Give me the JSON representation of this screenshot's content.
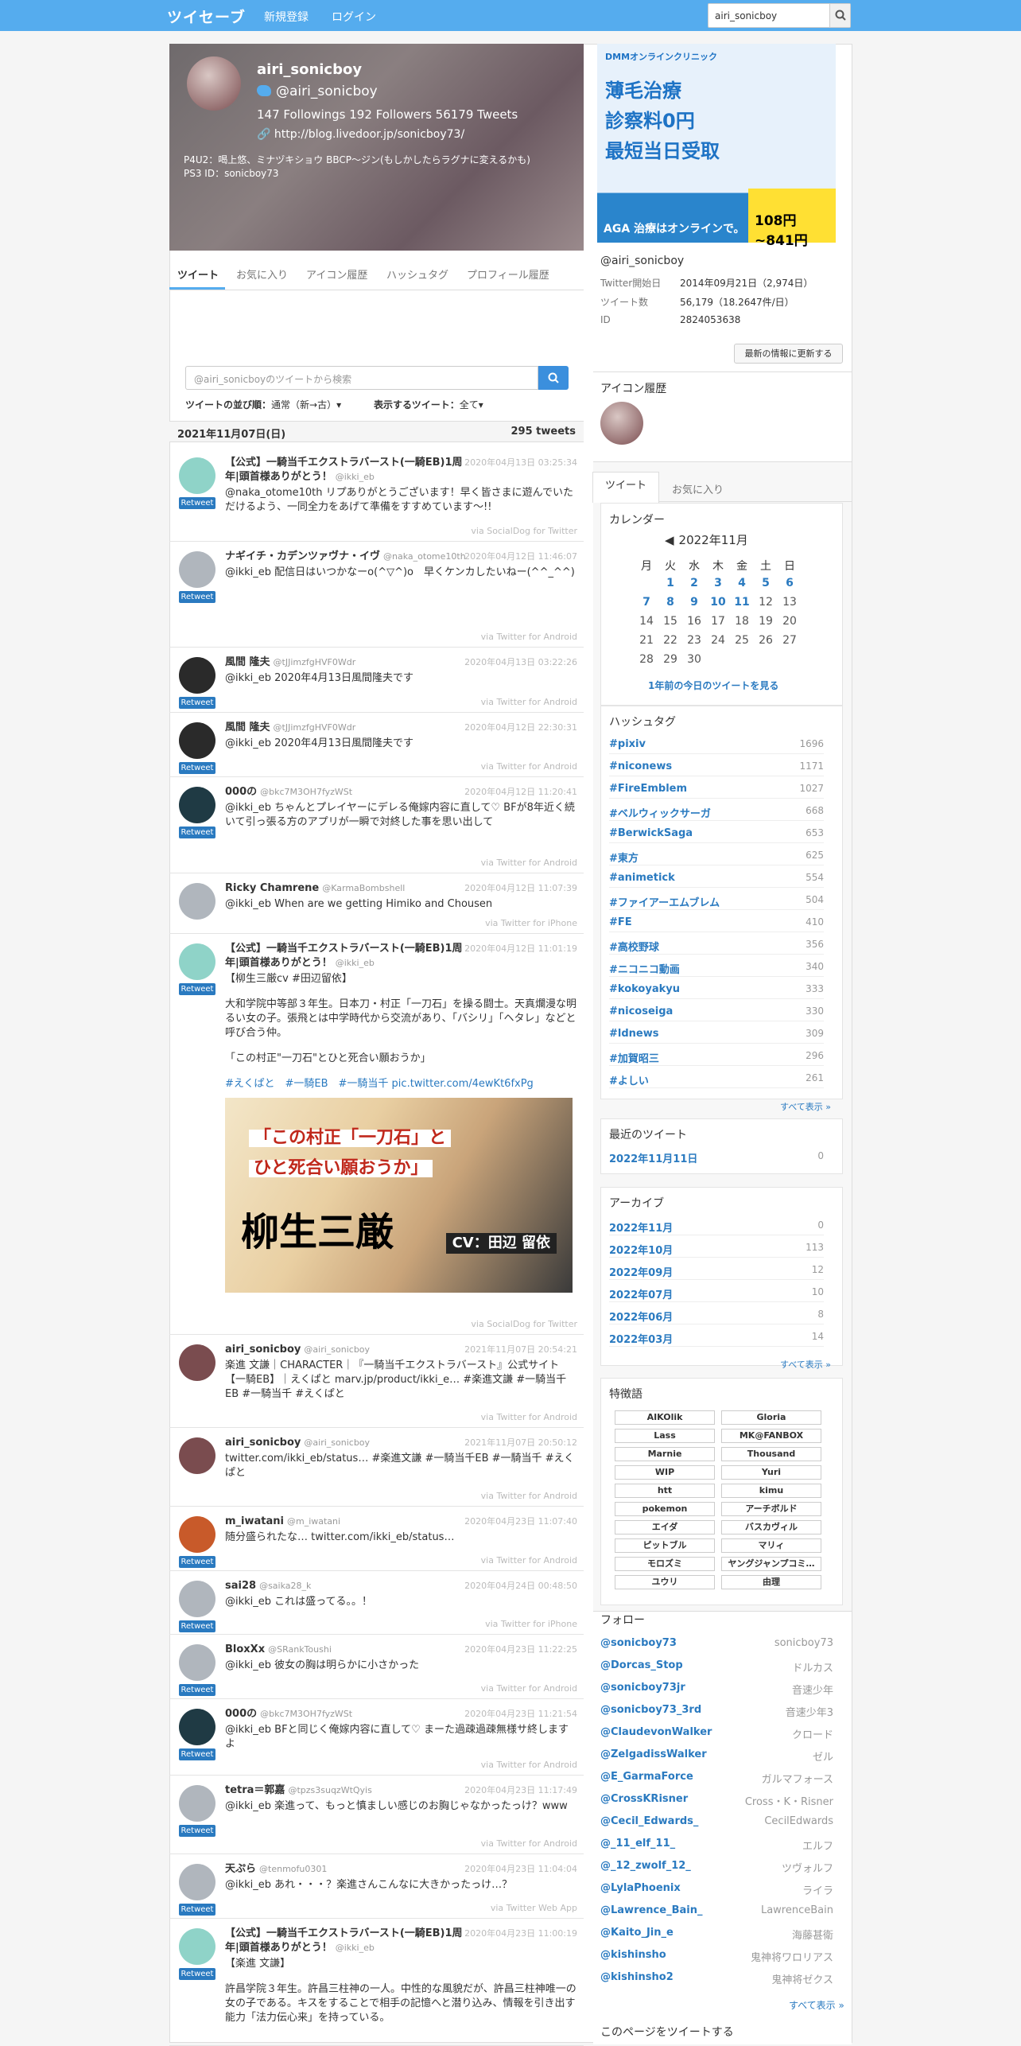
{
  "topbar": {
    "logo": "ツイセーブ",
    "signup": "新規登録",
    "login": "ログイン",
    "search_value": "airi_sonicboy"
  },
  "profile": {
    "name": "airi_sonicboy",
    "screen_name": "@airi_sonicboy",
    "counts": "147 Followings  192 Followers  56179 Tweets",
    "url": "http://blog.livedoor.jp/sonicboy73/",
    "bio1": "P4U2：喝上悠、ミナヅキショウ BBCP～ジン(もしかしたらラグナに変えるかも)",
    "bio2": "PS3 ID：sonicboy73"
  },
  "tabs": [
    "ツイート",
    "お気に入り",
    "アイコン履歴",
    "ハッシュタグ",
    "プロフィール履歴"
  ],
  "search": {
    "placeholder": "@airi_sonicboyのツイートから検索"
  },
  "sort": {
    "order_label": "ツイートの並び順：",
    "order_value": "通常（新→古）▾",
    "show_label": "表示するツイート：",
    "show_value": "全て▾"
  },
  "datebar": {
    "date": "2021年11月07日(日)",
    "count": "295 tweets"
  },
  "rt_label": "Retweet",
  "tweets": [
    {
      "name": "【公式】一騎当千エクストラバースト(一騎EB)1周年|頭首様ありがとう！",
      "sn": "@ikki_eb",
      "time": "2020年04月13日 03:25:34",
      "text": "@naka_otome10th リプありがとうございます！早く皆さまに遊んでいただけるよう、一同全力をあげて準備をすすめています～!!",
      "via": "via SocialDog for Twitter"
    },
    {
      "name": "ナギイチ・カデンツァヴナ・イヴ",
      "sn": "@naka_otome10th",
      "time": "2020年04月12日 11:46:07",
      "text": "@ikki_eb 配信日はいつかなーo(^▽^)o　早くケンカしたいねー(^^_^^)",
      "via": "via Twitter for Android"
    },
    {
      "name": "風間 隆夫",
      "sn": "@tJJimzfgHVF0Wdr",
      "time": "2020年04月13日 03:22:26",
      "text": "@ikki_eb 2020年4月13日風間隆夫です",
      "via": "via Twitter for Android"
    },
    {
      "name": "風間 隆夫",
      "sn": "@tJJimzfgHVF0Wdr",
      "time": "2020年04月12日 22:30:31",
      "text": "@ikki_eb 2020年4月13日風間隆夫です",
      "via": "via Twitter for Android"
    },
    {
      "name": "000の",
      "sn": "@bkc7M3OH7fyzWSt",
      "time": "2020年04月12日 11:20:41",
      "text": "@ikki_eb ちゃんとプレイヤーにデレる俺嫁内容に直して♡ BFが8年近く続いて引っ張る方のアプリが一瞬で対終した事を思い出して",
      "via": "via Twitter for Android"
    },
    {
      "name": "Ricky Chamrene",
      "sn": "@KarmaBombshell",
      "time": "2020年04月12日 11:07:39",
      "text": "@ikki_eb When are we getting Himiko and Chousen",
      "via": "via Twitter for iPhone"
    },
    {
      "name": "【公式】一騎当千エクストラバースト(一騎EB)1周年|頭首様ありがとう！",
      "sn": "@ikki_eb",
      "time": "2020年04月12日 11:01:19",
      "text": "【柳生三厳cv #田辺留依】",
      "via": "via SocialDog for Twitter"
    },
    {
      "name": "airi_sonicboy",
      "sn": "@airi_sonicboy",
      "time": "2021年11月07日 20:54:21",
      "text": "楽進 文謙｜CHARACTER｜『一騎当千エクストラバースト』公式サイト【一騎EB】｜えくぱと marv.jp/product/ikki_e… #楽進文謙 #一騎当千EB #一騎当千 #えくぱと",
      "via": "via Twitter for Android"
    },
    {
      "name": "airi_sonicboy",
      "sn": "@airi_sonicboy",
      "time": "2021年11月07日 20:50:12",
      "text": "twitter.com/ikki_eb/status… #楽進文謙 #一騎当千EB #一騎当千 #えくぱと",
      "via": "via Twitter for Android"
    },
    {
      "name": "m_iwatani",
      "sn": "@m_iwatani",
      "time": "2020年04月23日 11:07:40",
      "text": "随分盛られたな… twitter.com/ikki_eb/status…",
      "via": "via Twitter for Android"
    },
    {
      "name": "sai28",
      "sn": "@saika28_k",
      "time": "2020年04月24日 00:48:50",
      "text": "@ikki_eb これは盛ってる。。！",
      "via": "via Twitter for iPhone"
    },
    {
      "name": "BloxXx",
      "sn": "@SRankToushi",
      "time": "2020年04月23日 11:22:25",
      "text": "@ikki_eb 彼女の胸は明らかに小さかった",
      "via": "via Twitter for Android"
    },
    {
      "name": "000の",
      "sn": "@bkc7M3OH7fyzWSt",
      "time": "2020年04月23日 11:21:54",
      "text": "@ikki_eb BFと同じく俺嫁内容に直して♡ まーた過疎過疎無様サ終しますよ",
      "via": "via Twitter for Android"
    },
    {
      "name": "tetra＝郭嘉",
      "sn": "@tpzs3suqzWtQyis",
      "time": "2020年04月23日 11:17:49",
      "text": "@ikki_eb 楽進って、もっと慎ましい感じのお胸じゃなかったっけ？www",
      "via": "via Twitter for Android"
    },
    {
      "name": "天ぷら",
      "sn": "@tenmofu0301",
      "time": "2020年04月23日 11:04:04",
      "text": "@ikki_eb あれ・・・？楽進さんこんなに大きかったっけ…？",
      "via": "via Twitter Web App"
    },
    {
      "name": "【公式】一騎当千エクストラバースト(一騎EB)1周年|頭首様ありがとう！",
      "sn": "@ikki_eb",
      "time": "2020年04月23日 11:00:19",
      "text": "【楽進 文謙】",
      "via": ""
    }
  ],
  "tweet7_extra": {
    "p1": "大和学院中等部３年生。日本刀・村正「一刀石」を操る闘士。天真爛漫な明るい女の子。張飛とは中学時代から交流があり、「バシリ」「ヘタレ」などと呼び合う仲。",
    "p2": "「この村正\"一刀石\"とひと死合い願おうか」",
    "tags": "#えくぱと　#一騎EB　#一騎当千 pic.twitter.com/4ewKt6fxPg",
    "img_text1": "「この村正「一刀石」と",
    "img_text2": "ひと死合い願おうか」",
    "img_text3": "柳生三厳",
    "img_cv": "CV：田辺 留依"
  },
  "tweet16_extra": {
    "p1": "許昌学院３年生。許昌三柱神の一人。中性的な風貌だが、許昌三柱神唯一の女の子である。キスをすることで相手の記憶へと潜り込み、情報を引き出す能力「法力伝心来」を持っている。"
  },
  "ad": {
    "brand": "DMMオンラインクリニック",
    "l1": "薄毛治療",
    "l2": "診察料0円",
    "l3": "最短当日受取",
    "foot": "AGA 治療はオンラインで。",
    "price": "108円~841円"
  },
  "info": {
    "sn": "@airi_sonicboy",
    "rows": [
      [
        "Twitter開始日",
        "2014年09月21日（2,974日）"
      ],
      [
        "ツイート数",
        "56,179（18.2647件/日）"
      ],
      [
        "ID",
        "2824053638"
      ]
    ],
    "refresh": "最新の情報に更新する"
  },
  "icon_history_title": "アイコン履歴",
  "side_tabs": [
    "ツイート",
    "お気に入り"
  ],
  "calendar": {
    "title": "カレンダー",
    "month": "2022年11月",
    "dow": [
      "月",
      "火",
      "水",
      "木",
      "金",
      "土",
      "日"
    ],
    "weeks": [
      [
        "",
        "1",
        "2",
        "3",
        "4",
        "5",
        "6"
      ],
      [
        "7",
        "8",
        "9",
        "10",
        "11",
        "12",
        "13"
      ],
      [
        "14",
        "15",
        "16",
        "17",
        "18",
        "19",
        "20"
      ],
      [
        "21",
        "22",
        "23",
        "24",
        "25",
        "26",
        "27"
      ],
      [
        "28",
        "29",
        "30",
        "",
        "",
        "",
        ""
      ]
    ],
    "link": "1年前の今日のツイートを見る"
  },
  "hashtags": {
    "title": "ハッシュタグ",
    "items": [
      [
        "#pixiv",
        "1696"
      ],
      [
        "#niconews",
        "1171"
      ],
      [
        "#FireEmblem",
        "1027"
      ],
      [
        "#ベルウィックサーガ",
        "668"
      ],
      [
        "#BerwickSaga",
        "653"
      ],
      [
        "#東方",
        "625"
      ],
      [
        "#animetick",
        "554"
      ],
      [
        "#ファイアーエムブレム",
        "504"
      ],
      [
        "#FE",
        "410"
      ],
      [
        "#高校野球",
        "356"
      ],
      [
        "#ニコニコ動画",
        "340"
      ],
      [
        "#kokoyakyu",
        "333"
      ],
      [
        "#nicoseiga",
        "330"
      ],
      [
        "#ldnews",
        "309"
      ],
      [
        "#加賀昭三",
        "296"
      ],
      [
        "#よしい",
        "261"
      ]
    ],
    "more": "すべて表示 »"
  },
  "recent": {
    "title": "最近のツイート",
    "date": "2022年11月11日",
    "count": "0"
  },
  "archive": {
    "title": "アーカイブ",
    "items": [
      [
        "2022年11月",
        "0"
      ],
      [
        "2022年10月",
        "113"
      ],
      [
        "2022年09月",
        "12"
      ],
      [
        "2022年07月",
        "10"
      ],
      [
        "2022年06月",
        "8"
      ],
      [
        "2022年03月",
        "14"
      ]
    ],
    "more": "すべて表示 »"
  },
  "keywords": {
    "title": "特徴語",
    "items": [
      "AIKOlik",
      "Gloria",
      "Lass",
      "MK@FANBOX",
      "Marnie",
      "Thousand",
      "WIP",
      "Yuri",
      "htt",
      "kimu",
      "pokemon",
      "アーチボルド",
      "エイダ",
      "バスカヴィル",
      "ピットブル",
      "マリィ",
      "モロズミ",
      "ヤングジャンプコミ…",
      "ユウリ",
      "由理"
    ]
  },
  "follow": {
    "title": "フォロー",
    "items": [
      [
        "@sonicboy73",
        "sonicboy73"
      ],
      [
        "@Dorcas_Stop",
        "ドルカス"
      ],
      [
        "@sonicboy73jr",
        "音速少年"
      ],
      [
        "@sonicboy73_3rd",
        "音速少年3"
      ],
      [
        "@ClaudevonWalker",
        "クロード"
      ],
      [
        "@ZelgadissWalker",
        "ゼル"
      ],
      [
        "@E_GarmaForce",
        "ガルマフォース"
      ],
      [
        "@CrossKRisner",
        "Cross・K・Risner"
      ],
      [
        "@Cecil_Edwards_",
        "CecilEdwards"
      ],
      [
        "@_11_elf_11_",
        "エルフ"
      ],
      [
        "@_12_zwolf_12_",
        "ツヴォルフ"
      ],
      [
        "@LylaPhoenix",
        "ライラ"
      ],
      [
        "@Lawrence_Bain_",
        "LawrenceBain"
      ],
      [
        "@Kaito_Jin_e",
        "海藤甚衛"
      ],
      [
        "@kishinsho",
        "鬼神将ワロリアス"
      ],
      [
        "@kishinsho2",
        "鬼神将ゼクス"
      ]
    ],
    "more": "すべて表示 »"
  },
  "tweet_page": "このページをツイートする",
  "colors": {
    "accent": "#55acee",
    "link": "#2a7ac0"
  }
}
